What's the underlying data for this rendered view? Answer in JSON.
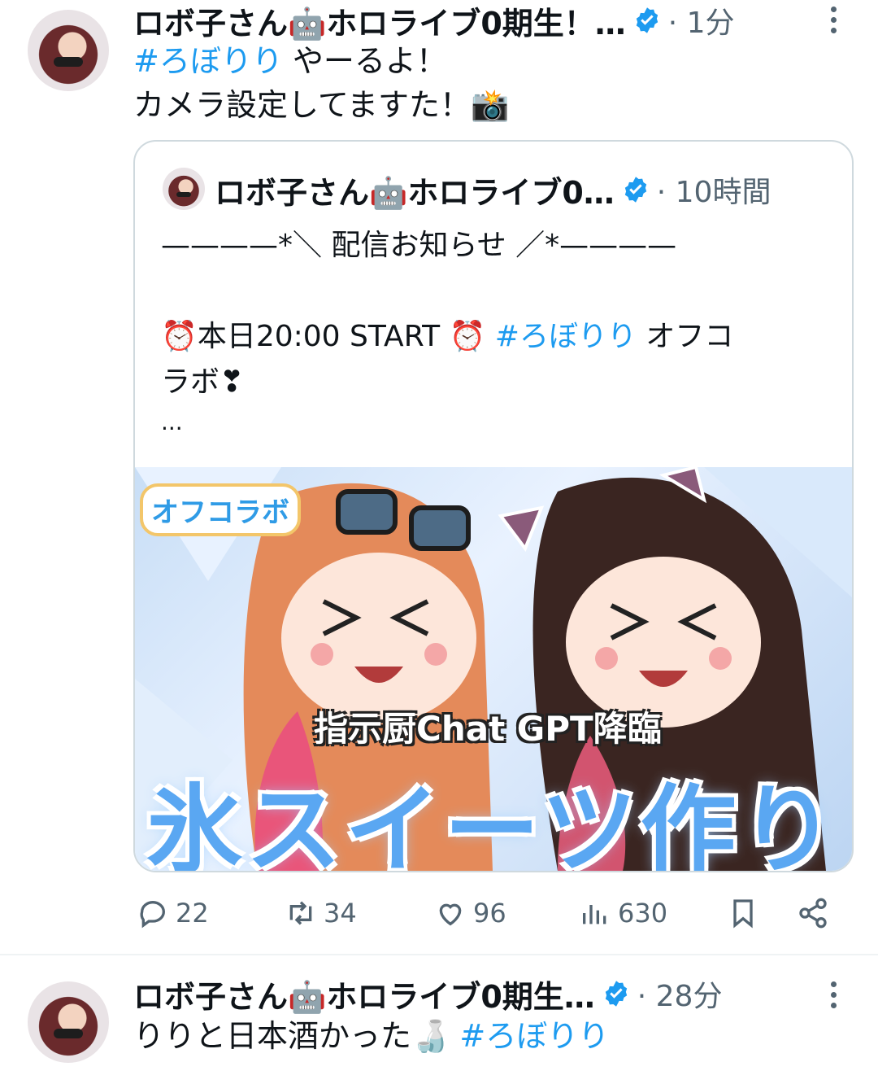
{
  "tweet1": {
    "name": "ロボ子さん🤖ホロライブ0期生！…",
    "time": "· 1分",
    "line1_hashtag": "#ろぼりり",
    "line1_rest": " やーるよ！",
    "line2": "カメラ設定してますた！📸",
    "quote": {
      "name": "ロボ子さん🤖ホロライブ0…",
      "time": "· 10時間",
      "line1": "————*＼ 配信お知らせ ／*————",
      "line2_prefix": "⏰本日20:00 START ⏰ ",
      "line2_hashtag": "#ろぼりり",
      "line2_suffix": " オフコ",
      "line3": "ラボ❣",
      "line4": "...",
      "thumbnail": {
        "badge": "オフコラボ",
        "subtitle": "指示厨Chat GPT降臨",
        "title": "氷スイーツ作り"
      }
    },
    "actions": {
      "replies": "22",
      "retweets": "34",
      "likes": "96",
      "views": "630"
    }
  },
  "tweet2": {
    "name": "ロボ子さん🤖ホロライブ0期生…",
    "time": "· 28分",
    "text_plain": "りりと日本酒かった🍶 ",
    "text_hashtag": "#ろぼりり"
  },
  "colors": {
    "accent": "#1d9bf0",
    "muted": "#536471",
    "border": "#cfd9de"
  },
  "icons": [
    "verified-badge-icon",
    "more-icon",
    "reply-icon",
    "retweet-icon",
    "like-icon",
    "views-icon",
    "bookmark-icon",
    "share-icon"
  ]
}
